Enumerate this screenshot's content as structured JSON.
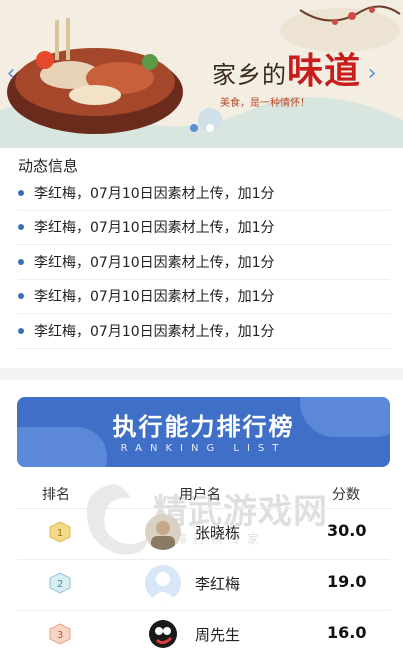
{
  "banner": {
    "calligraphy_small": "家乡的",
    "calligraphy_big": "味道",
    "subline": "美食，是一种情怀！",
    "slide_count": 2,
    "active_slide": 1
  },
  "feed": {
    "title": "动态信息",
    "items": [
      "李红梅，07月10日因素材上传，加1分",
      "李红梅，07月10日因素材上传，加1分",
      "李红梅，07月10日因素材上传，加1分",
      "李红梅，07月10日因素材上传，加1分",
      "李红梅，07月10日因素材上传，加1分"
    ]
  },
  "ranking": {
    "title": "执行能力排行榜",
    "subtitle": "RANKING LIST",
    "headers": {
      "rank": "排名",
      "user": "用户名",
      "score": "分数"
    },
    "rows": [
      {
        "rank": "1",
        "name": "张晓栋",
        "score": "30.0"
      },
      {
        "rank": "2",
        "name": "李红梅",
        "score": "19.0"
      },
      {
        "rank": "3",
        "name": "周先生",
        "score": "16.0"
      }
    ]
  },
  "watermark": {
    "text": "精武游戏网",
    "sub": "排行榜专家"
  },
  "colors": {
    "accent": "#3f6fc6",
    "bullet": "#3d6fb4",
    "gold": "#e8c66a",
    "silver": "#8fc7d8",
    "bronze": "#e4a28a"
  }
}
